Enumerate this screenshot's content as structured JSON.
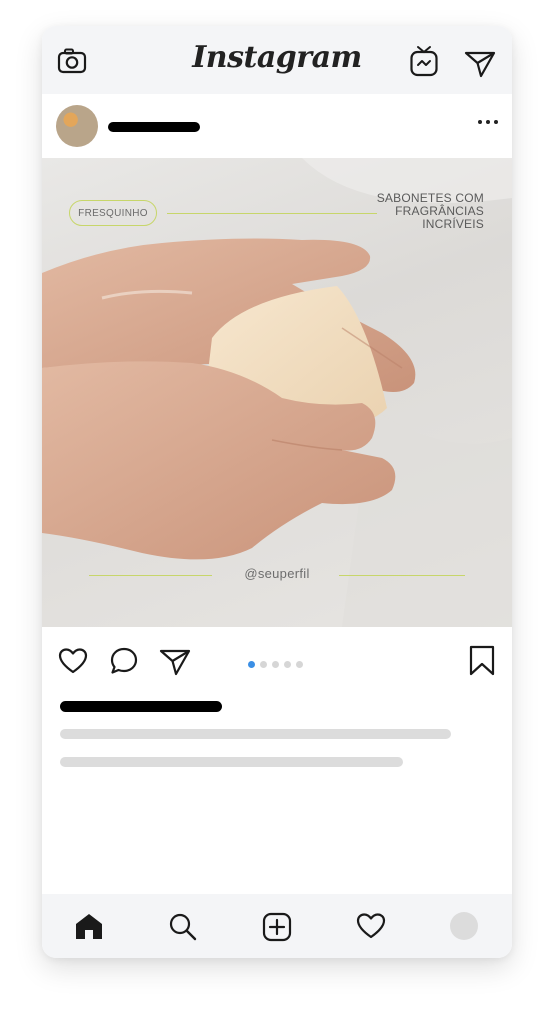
{
  "app": {
    "logo_text": "Instagram"
  },
  "post": {
    "tag_label": "FRESQUINHO",
    "headline": "SABONETES COM\nFRAGRÂNCIAS\nINCRÍVEIS",
    "handle": "@seuperfil",
    "carousel": {
      "total": 5,
      "active_index": 0
    }
  },
  "icons": {
    "camera": "camera-icon",
    "igtv": "igtv-icon",
    "direct": "paper-plane-icon",
    "more": "more-dots-icon",
    "like": "heart-icon",
    "comment": "comment-icon",
    "share": "paper-plane-icon",
    "save": "bookmark-icon",
    "home": "home-icon",
    "search": "search-icon",
    "add": "add-post-icon",
    "activity": "heart-icon"
  },
  "colors": {
    "accent_line": "#c7d66a",
    "active_dot": "#3b8fe5",
    "placeholder_bar": "#dcdcdc"
  }
}
